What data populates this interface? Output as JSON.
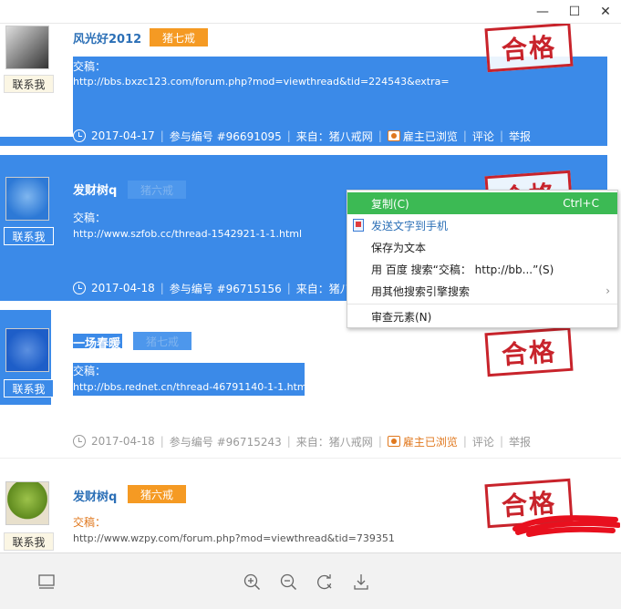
{
  "window": {
    "min": "—",
    "max": "☐",
    "close": "✕"
  },
  "entries": [
    {
      "username": "风光好2012",
      "badge": "猪七戒",
      "contact": "联系我",
      "label": "交稿：",
      "url": "http://bbs.bxzc123.com/forum.php?mod=viewthread&tid=224543&extra=",
      "date": "2017-04-17",
      "number": "参与编号 #96691095",
      "from": "来自：猪八戒网",
      "viewed": "雇主已浏览",
      "comment": "评论",
      "report": "举报",
      "stamp": "合格"
    },
    {
      "username": "发财树q",
      "badge": "猪六戒",
      "contact": "联系我",
      "label": "交稿：",
      "url": "http://www.szfob.cc/thread-1542921-1-1.html",
      "date": "2017-04-18",
      "number": "参与编号 #96715156",
      "from": "来自：猪八戒网",
      "stamp": "合格"
    },
    {
      "username": "一场春暖",
      "badge": "猪七戒",
      "contact": "联系我",
      "label": "交稿：",
      "url": "http://bbs.rednet.cn/thread-46791140-1-1.html",
      "date": "2017-04-18",
      "number": "参与编号 #96715243",
      "from": "来自：猪八戒网",
      "viewed": "雇主已浏览",
      "comment": "评论",
      "report": "举报",
      "stamp": "合格"
    },
    {
      "username": "发财树q",
      "badge": "猪六戒",
      "contact": "联系我",
      "label": "交稿：",
      "url": "http://www.wzpy.com/forum.php?mod=viewthread&tid=739351",
      "stamp": "合格"
    }
  ],
  "context_menu": {
    "copy": "复制(C)",
    "copy_shortcut": "Ctrl+C",
    "send_to_phone": "发送文字到手机",
    "save_as_text": "保存为文本",
    "search_baidu": "用 百度 搜索“交稿： http://bb...”(S)",
    "search_other": "用其他搜索引擎搜索",
    "inspect": "审查元素(N)"
  },
  "colors": {
    "selection": "#3b8ae8",
    "menu_highlight": "#3cba54",
    "stamp_red": "#c8232b",
    "badge_orange": "#f59a23",
    "username_blue": "#2b6fb6"
  },
  "toolbar_icons": [
    "fit-page-icon",
    "zoom-in-icon",
    "zoom-out-icon",
    "rotate-icon",
    "download-icon"
  ]
}
